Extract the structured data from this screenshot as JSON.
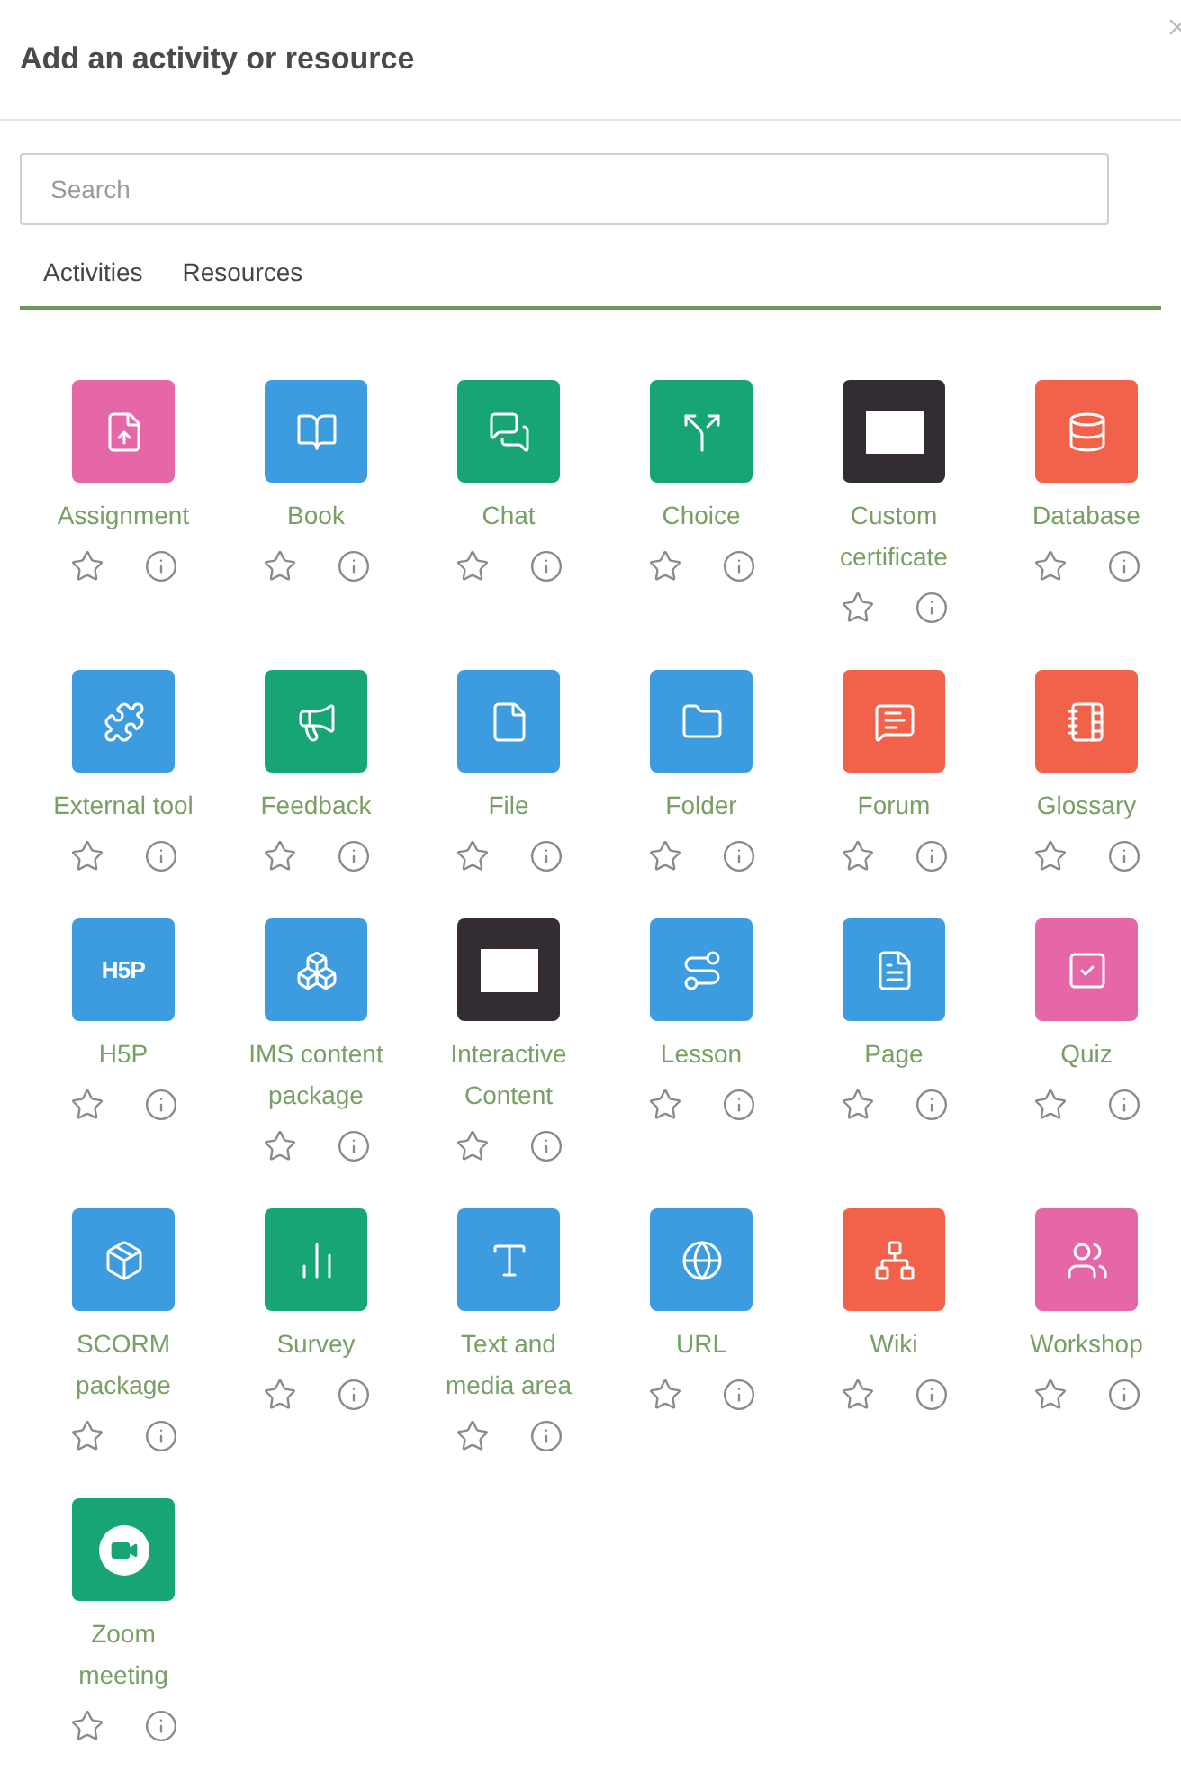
{
  "dialog": {
    "title": "Add an activity or resource"
  },
  "search": {
    "placeholder": "Search"
  },
  "tabs": [
    {
      "label": "Activities"
    },
    {
      "label": "Resources"
    }
  ],
  "items": [
    {
      "label": "Assignment",
      "kind": "assignment",
      "color": "#e667a8"
    },
    {
      "label": "Book",
      "kind": "book",
      "color": "#3d9be0"
    },
    {
      "label": "Chat",
      "kind": "chat",
      "color": "#17a673"
    },
    {
      "label": "Choice",
      "kind": "choice",
      "color": "#17a673"
    },
    {
      "label": "Custom certificate",
      "kind": "blank",
      "color": "#332c33"
    },
    {
      "label": "Database",
      "kind": "database",
      "color": "#f2624a"
    },
    {
      "label": "External tool",
      "kind": "puzzle",
      "color": "#3d9be0"
    },
    {
      "label": "Feedback",
      "kind": "megaphone",
      "color": "#17a673"
    },
    {
      "label": "File",
      "kind": "file",
      "color": "#3d9be0"
    },
    {
      "label": "Folder",
      "kind": "folder",
      "color": "#3d9be0"
    },
    {
      "label": "Forum",
      "kind": "forum",
      "color": "#f2624a"
    },
    {
      "label": "Glossary",
      "kind": "notebook",
      "color": "#f2624a"
    },
    {
      "label": "H5P",
      "kind": "text",
      "icon_text": "H5P",
      "color": "#3d9be0"
    },
    {
      "label": "IMS content package",
      "kind": "boxes",
      "color": "#3d9be0"
    },
    {
      "label": "Interactive Content",
      "kind": "blank",
      "color": "#332c33"
    },
    {
      "label": "Lesson",
      "kind": "route",
      "color": "#3d9be0"
    },
    {
      "label": "Page",
      "kind": "page",
      "color": "#3d9be0"
    },
    {
      "label": "Quiz",
      "kind": "check",
      "color": "#e667a8"
    },
    {
      "label": "SCORM package",
      "kind": "package",
      "color": "#3d9be0"
    },
    {
      "label": "Survey",
      "kind": "chart",
      "color": "#17a673"
    },
    {
      "label": "Text and media area",
      "kind": "type",
      "color": "#3d9be0"
    },
    {
      "label": "URL",
      "kind": "globe",
      "color": "#3d9be0"
    },
    {
      "label": "Wiki",
      "kind": "network",
      "color": "#f2624a"
    },
    {
      "label": "Workshop",
      "kind": "users",
      "color": "#e667a8"
    },
    {
      "label": "Zoom meeting",
      "kind": "video",
      "color": "#17a673"
    }
  ]
}
